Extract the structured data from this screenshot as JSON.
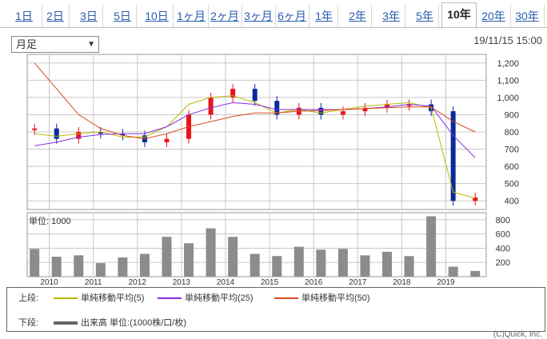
{
  "tabs": [
    {
      "label": "1日",
      "active": false
    },
    {
      "label": "2日",
      "active": false
    },
    {
      "label": "3日",
      "active": false
    },
    {
      "label": "5日",
      "active": false
    },
    {
      "label": "10日",
      "active": false
    },
    {
      "label": "1ヶ月",
      "active": false
    },
    {
      "label": "2ヶ月",
      "active": false
    },
    {
      "label": "3ヶ月",
      "active": false
    },
    {
      "label": "6ヶ月",
      "active": false
    },
    {
      "label": "1年",
      "active": false
    },
    {
      "label": "2年",
      "active": false
    },
    {
      "label": "3年",
      "active": false
    },
    {
      "label": "5年",
      "active": false
    },
    {
      "label": "10年",
      "active": true
    },
    {
      "label": "20年",
      "active": false
    },
    {
      "label": "30年",
      "active": false
    }
  ],
  "period_select": {
    "value": "月足"
  },
  "timestamp": "19/11/15 15:00",
  "volume_label": "単位: 1000",
  "legend": {
    "upper_label": "上段:",
    "lower_label": "下段:",
    "items": [
      {
        "label": "単純移動平均(5)",
        "color": "#b8b800"
      },
      {
        "label": "単純移動平均(25)",
        "color": "#8a2be2"
      },
      {
        "label": "単純移動平均(50)",
        "color": "#d94a1a"
      }
    ],
    "volume_item": "出来高 単位:(1000株/口/枚)",
    "volume_color": "#666666"
  },
  "copyright": "(C)Quick, Inc.",
  "colors": {
    "up": "#e8141c",
    "down": "#0a2a9c",
    "grid": "#c8c8c8",
    "volume": "#8c8c8c"
  },
  "chart_data": [
    {
      "type": "candlestick",
      "yticks": [
        400,
        500,
        600,
        700,
        800,
        900,
        1000,
        1100,
        1200
      ],
      "ylim": [
        350,
        1250
      ],
      "xticks": [
        "2010",
        "2011",
        "2012",
        "2013",
        "2014",
        "2015",
        "2016",
        "2017",
        "2018",
        "2019"
      ],
      "x_range": [
        "2009-07",
        "2019-12"
      ],
      "period_labels": [
        "2009-09",
        "2010-03",
        "2010-09",
        "2011-03",
        "2011-09",
        "2012-03",
        "2012-09",
        "2013-03",
        "2013-09",
        "2014-03",
        "2014-09",
        "2015-03",
        "2015-09",
        "2016-03",
        "2016-09",
        "2017-03",
        "2017-09",
        "2018-03",
        "2018-09",
        "2019-03",
        "2019-09"
      ],
      "close": [
        820,
        760,
        800,
        790,
        780,
        740,
        760,
        900,
        1000,
        1050,
        980,
        900,
        940,
        900,
        920,
        940,
        960,
        960,
        920,
        400,
        420
      ],
      "ma_series": [
        {
          "name": "単純移動平均(5)",
          "values": [
            790,
            775,
            790,
            800,
            770,
            770,
            830,
            960,
            1000,
            1010,
            970,
            910,
            930,
            910,
            930,
            950,
            960,
            970,
            940,
            450,
            415
          ]
        },
        {
          "name": "単純移動平均(25)",
          "values": [
            720,
            740,
            770,
            785,
            790,
            790,
            830,
            900,
            940,
            970,
            960,
            930,
            930,
            930,
            930,
            935,
            945,
            960,
            950,
            780,
            650
          ]
        },
        {
          "name": "単純移動平均(50)",
          "values": [
            1200,
            1050,
            900,
            820,
            780,
            760,
            790,
            830,
            860,
            890,
            910,
            910,
            920,
            925,
            930,
            935,
            940,
            945,
            945,
            860,
            800
          ]
        }
      ]
    },
    {
      "type": "bar",
      "title": "単位: 1000",
      "yticks": [
        200,
        400,
        600,
        800
      ],
      "ylim": [
        0,
        900
      ],
      "xticks": [
        "2010",
        "2011",
        "2012",
        "2013",
        "2014",
        "2015",
        "2016",
        "2017",
        "2018",
        "2019"
      ],
      "x_range": [
        "2009-07",
        "2019-12"
      ],
      "period_labels": [
        "2009-09",
        "2010-03",
        "2010-09",
        "2011-03",
        "2011-09",
        "2012-03",
        "2012-09",
        "2013-03",
        "2013-09",
        "2014-03",
        "2014-09",
        "2015-03",
        "2015-09",
        "2016-03",
        "2016-09",
        "2017-03",
        "2017-09",
        "2018-03",
        "2018-09",
        "2019-03",
        "2019-09"
      ],
      "values": [
        390,
        280,
        300,
        190,
        270,
        320,
        560,
        470,
        680,
        560,
        320,
        290,
        420,
        380,
        390,
        300,
        350,
        290,
        850,
        140,
        80
      ]
    }
  ]
}
